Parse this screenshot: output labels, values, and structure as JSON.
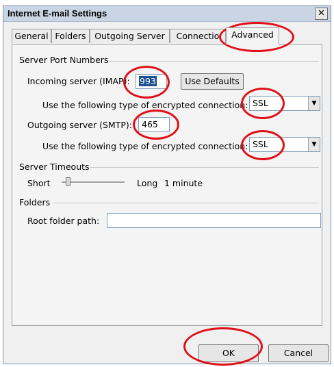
{
  "window": {
    "title": "Internet E-mail Settings",
    "close_glyph": "✕"
  },
  "tabs": [
    {
      "label": "General"
    },
    {
      "label": "Folders"
    },
    {
      "label": "Outgoing Server"
    },
    {
      "label": "Connectio"
    },
    {
      "label": "Advanced"
    }
  ],
  "server_ports": {
    "heading": "Server Port Numbers",
    "incoming_label": "Incoming server (IMAP):",
    "incoming_value": "993",
    "use_defaults_label": "Use Defaults",
    "incoming_encryption_label": "Use the following type of encrypted connection:",
    "incoming_encryption_value": "SSL",
    "outgoing_label": "Outgoing server (SMTP):",
    "outgoing_value": "465",
    "outgoing_encryption_label": "Use the following type of encrypted connection:",
    "outgoing_encryption_value": "SSL"
  },
  "timeouts": {
    "heading": "Server Timeouts",
    "short_label": "Short",
    "long_label": "Long",
    "value_label": "1 minute",
    "slider_level": 0.1
  },
  "folders": {
    "heading": "Folders",
    "root_label": "Root folder path:",
    "root_value": ""
  },
  "footer": {
    "ok_label": "OK",
    "cancel_label": "Cancel"
  },
  "colors": {
    "annotation": "#e0101a",
    "selection": "#1c4f8f"
  }
}
